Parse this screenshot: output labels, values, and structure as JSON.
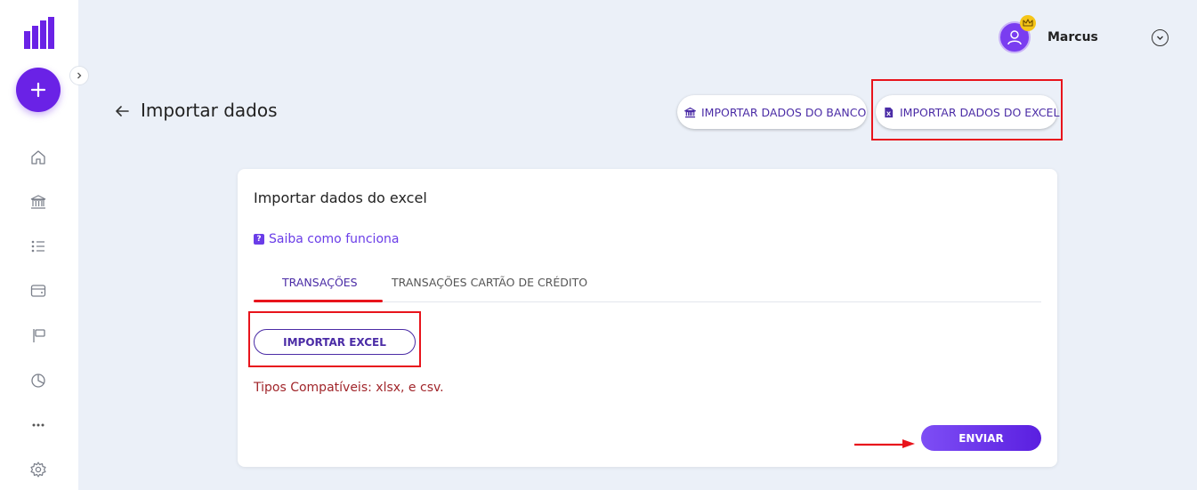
{
  "user": {
    "name": "Marcus"
  },
  "page": {
    "title": "Importar dados"
  },
  "header_buttons": {
    "bank_label": "IMPORTAR DADOS DO BANCO",
    "excel_label": "IMPORTAR DADOS DO EXCEL"
  },
  "card": {
    "title": "Importar dados do excel",
    "help_link": "Saiba como funciona",
    "tabs": [
      {
        "label": "TRANSAÇÕES",
        "active": true
      },
      {
        "label": "TRANSAÇÕES CARTÃO DE CRÉDITO",
        "active": false
      }
    ],
    "import_button": "IMPORTAR EXCEL",
    "compatible_types": "Tipos Compatíveis: xlsx, e csv.",
    "send_button": "ENVIAR"
  },
  "sidebar": {
    "items": [
      "home-icon",
      "bank-icon",
      "list-icon",
      "wallet-icon",
      "flag-icon",
      "pie-chart-icon",
      "more-icon",
      "settings-icon"
    ]
  },
  "colors": {
    "primary": "#6a22e6",
    "accent_text": "#4b2ca6",
    "annotation_red": "#e8141c",
    "background": "#ebf0f8",
    "info_text": "#a1262b"
  }
}
